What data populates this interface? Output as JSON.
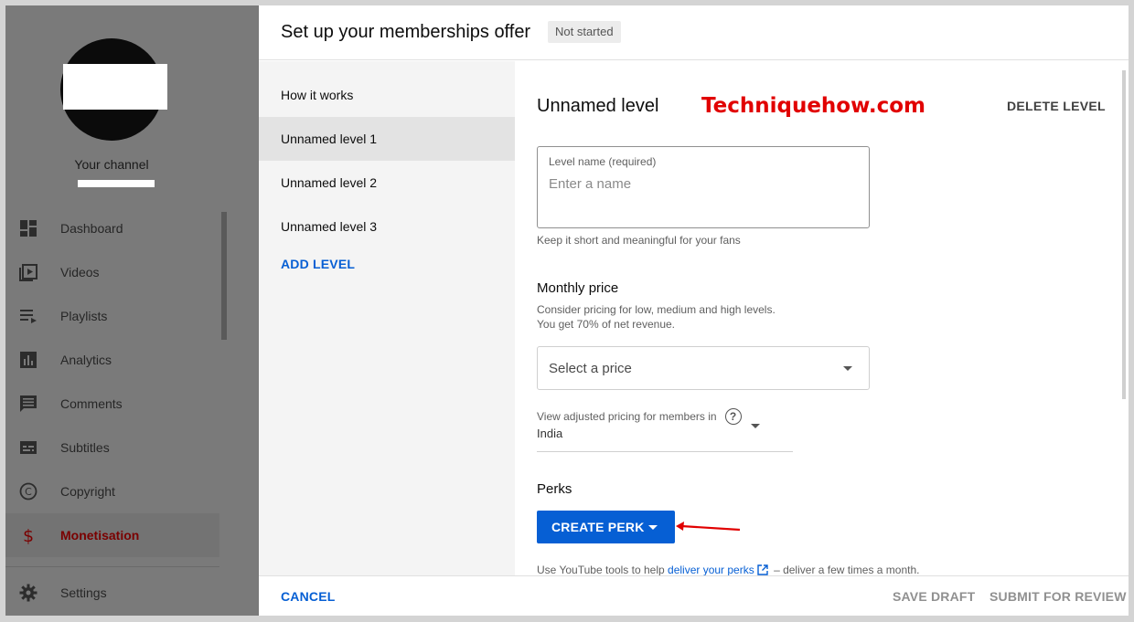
{
  "sidebar": {
    "channel_label": "Your channel",
    "items": [
      {
        "label": "Dashboard",
        "icon": "dashboard-icon"
      },
      {
        "label": "Videos",
        "icon": "videos-icon"
      },
      {
        "label": "Playlists",
        "icon": "playlists-icon"
      },
      {
        "label": "Analytics",
        "icon": "analytics-icon"
      },
      {
        "label": "Comments",
        "icon": "comments-icon"
      },
      {
        "label": "Subtitles",
        "icon": "subtitles-icon"
      },
      {
        "label": "Copyright",
        "icon": "copyright-icon"
      },
      {
        "label": "Monetisation",
        "icon": "dollar-icon"
      },
      {
        "label": "Settings",
        "icon": "gear-icon"
      }
    ],
    "active_color": "#7a0000"
  },
  "dialog": {
    "title": "Set up your memberships offer",
    "status": "Not started",
    "nav": {
      "items": [
        "How it works",
        "Unnamed level 1",
        "Unnamed level 2",
        "Unnamed level 3"
      ],
      "selected": "Unnamed level 1",
      "add_label": "ADD LEVEL"
    },
    "level": {
      "title": "Unnamed level",
      "delete_label": "DELETE LEVEL",
      "name_field": {
        "label": "Level name (required)",
        "placeholder": "Enter a name",
        "helper": "Keep it short and meaningful for your fans"
      },
      "price": {
        "title": "Monthly price",
        "desc_line1": "Consider pricing for low, medium and high levels.",
        "desc_line2": "You get 70% of net revenue.",
        "select_value": "Select a price"
      },
      "region": {
        "label": "View adjusted pricing for members in",
        "value": "India"
      },
      "perks": {
        "title": "Perks",
        "create_label": "CREATE PERK",
        "info_prefix": "Use YouTube tools to help",
        "info_link": "deliver your perks",
        "info_suffix": "– deliver a few times a month."
      }
    },
    "footer": {
      "cancel": "CANCEL",
      "save_draft": "SAVE DRAFT",
      "submit": "SUBMIT FOR REVIEW"
    }
  },
  "watermark": "Techniquehow.com",
  "colors": {
    "accent": "#065fd4",
    "watermark": "#e10000",
    "annotation_arrow": "#e10000"
  }
}
